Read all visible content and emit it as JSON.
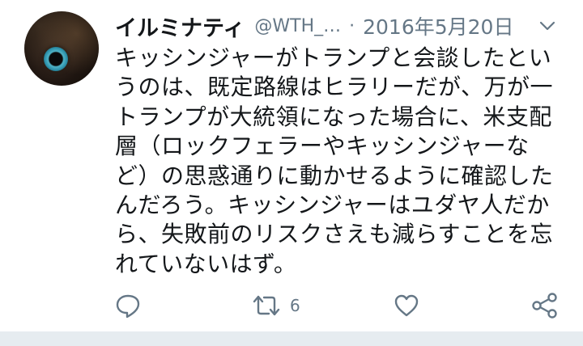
{
  "tweet": {
    "display_name": "イルミナティ",
    "handle": "@WTH_…",
    "separator": "·",
    "date": "2016年5月20日",
    "text_lines": [
      "キッシンジャーがトランプと会談したとい",
      "うのは、既定路線はヒラリーだが、万が一",
      "トランプが大統領になった場合に、米支配",
      "層（ロックフェラーやキッシンジャーな",
      "ど）の思惑通りに動かせるように確認した",
      "んだろう。キッシンジャーはユダヤ人だか",
      "ら、失敗前のリスクさえも減らすことを忘",
      "れていないはず。"
    ]
  },
  "actions": {
    "reply_icon": "reply-icon",
    "retweet_icon": "retweet-icon",
    "retweet_count": "6",
    "like_icon": "heart-icon",
    "share_icon": "share-icon"
  },
  "colors": {
    "text_primary": "#14171a",
    "text_secondary": "#657786",
    "icon": "#657786",
    "divider_band": "#e6ecf0"
  }
}
